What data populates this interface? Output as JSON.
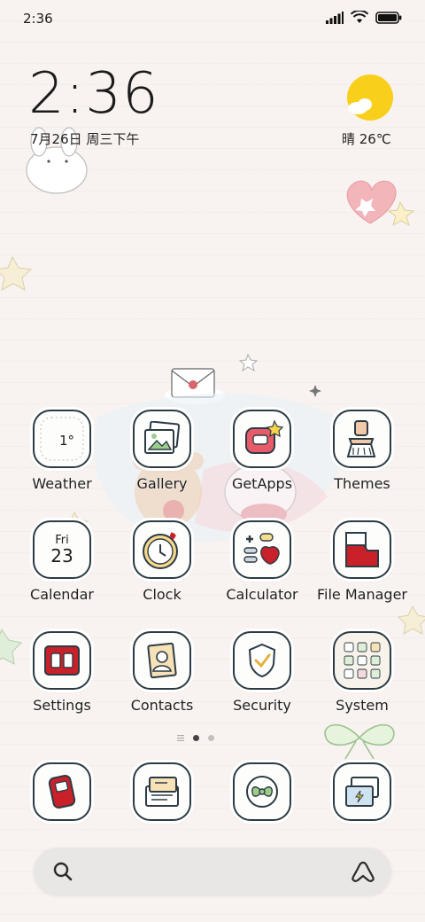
{
  "status_bar": {
    "time": "2:36",
    "icons": [
      "signal-icon",
      "wifi-icon",
      "battery-icon"
    ]
  },
  "clock_widget": {
    "time": "2:36",
    "date": "7月26日 周三下午"
  },
  "weather_widget": {
    "condition_icon": "partly-sunny-icon",
    "text": "晴 26℃"
  },
  "apps": [
    {
      "label": "Weather",
      "icon": "weather-icon",
      "badge_text": "1°"
    },
    {
      "label": "Gallery",
      "icon": "gallery-icon"
    },
    {
      "label": "GetApps",
      "icon": "getapps-icon"
    },
    {
      "label": "Themes",
      "icon": "themes-icon"
    },
    {
      "label": "Calendar",
      "icon": "calendar-icon",
      "day_name": "Fri",
      "day_num": "23"
    },
    {
      "label": "Clock",
      "icon": "clock-icon"
    },
    {
      "label": "Calculator",
      "icon": "calculator-icon"
    },
    {
      "label": "File Manager",
      "icon": "file-manager-icon"
    },
    {
      "label": "Settings",
      "icon": "settings-icon"
    },
    {
      "label": "Contacts",
      "icon": "contacts-icon"
    },
    {
      "label": "Security",
      "icon": "security-icon"
    },
    {
      "label": "System",
      "icon": "system-folder-icon"
    }
  ],
  "page_indicator": {
    "pages": 2,
    "current": 1
  },
  "dock": [
    {
      "icon": "phone-icon"
    },
    {
      "icon": "messages-icon"
    },
    {
      "icon": "browser-icon"
    },
    {
      "icon": "camera-icon"
    }
  ],
  "search": {
    "icon": "search-icon",
    "assistant_icon": "assistant-icon"
  },
  "colors": {
    "accent_red": "#c9202a",
    "tile_border": "#2c3b43",
    "background": "#f8f3f0"
  }
}
